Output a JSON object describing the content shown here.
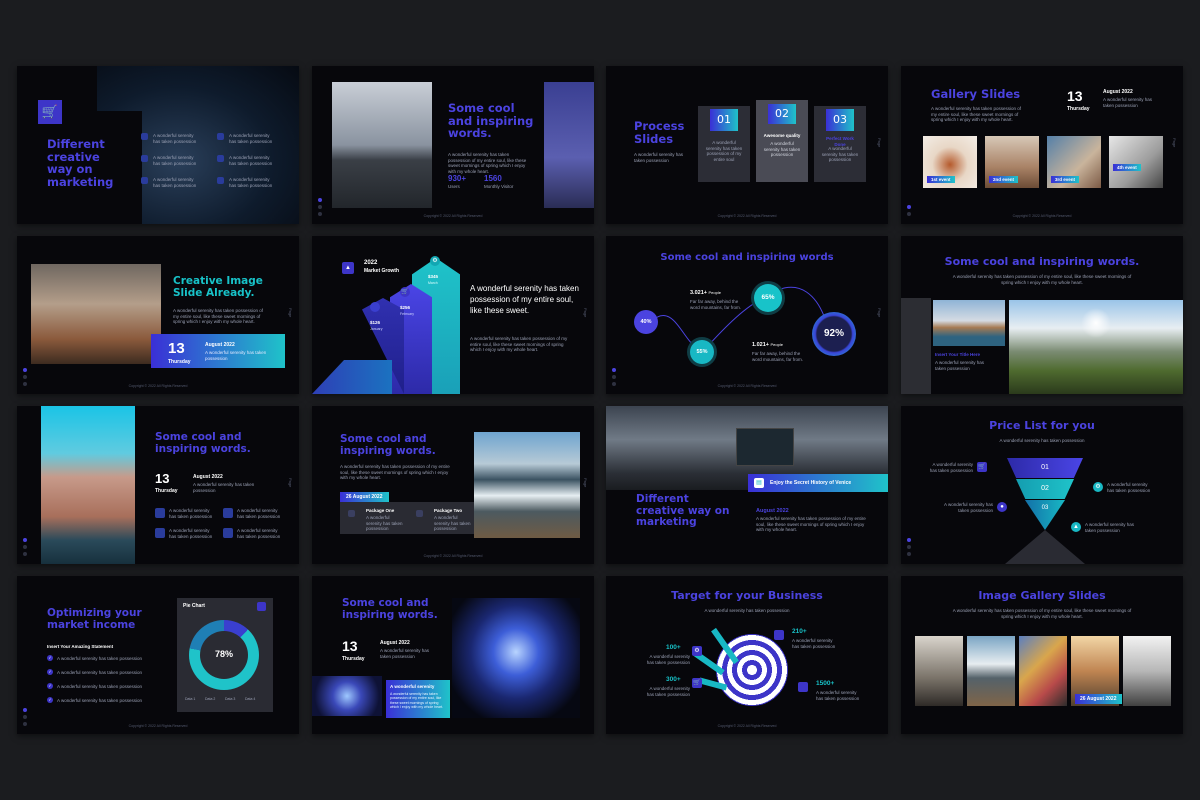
{
  "common": {
    "copyright": "Copyright © 2022 All Rights Reserved",
    "page_label": "Page",
    "body_short": "A wonderful serenity has taken possession",
    "body_long": "A wonderful serenity has taken possession of my entire soul, like these sweet mornings of spring which I enjoy with my whole heart."
  },
  "s1": {
    "title": "Different creative way on marketing",
    "cart_icon": "cart-icon"
  },
  "s2": {
    "title": "Some cool and inspiring words.",
    "stat1_value": "930+",
    "stat1_label": "Users",
    "stat2_value": "1560",
    "stat2_label": "Monthly Visitor"
  },
  "s3": {
    "title": "Process Slides",
    "steps": [
      {
        "num": "01",
        "label": "A wonderful serenity has taken possession of my entire soul"
      },
      {
        "num": "02",
        "label": "Awesome quality"
      },
      {
        "num": "03",
        "label": "Perfect Work Done"
      }
    ]
  },
  "s4": {
    "title": "Gallery Slides",
    "day": "13",
    "weekday": "Thursday",
    "month": "August 2022",
    "tags": [
      "1st event",
      "2nd event",
      "3rd event",
      "4th event"
    ]
  },
  "s5": {
    "title": "Creative Image Slide Already.",
    "day": "13",
    "weekday": "Thursday",
    "month": "August 2022"
  },
  "s6": {
    "year": "2022",
    "sub": "Market Growth",
    "bars": [
      "$126",
      "$256",
      "$345"
    ],
    "bar_labels": [
      "January",
      "February",
      "March"
    ],
    "headline": "A wonderful serenity has taken possession of my entire soul, like these sweet."
  },
  "s7": {
    "title": "Some cool and inspiring words",
    "p1": "40%",
    "p2": "55%",
    "p3": "65%",
    "p4": "92%",
    "n1": "3.021+",
    "n1l": "People",
    "n1t": "Far far away, behind the word mountains, far from.",
    "n2": "1.021+",
    "n2l": "People",
    "n2t": "Far far away, behind the word mountains, far from."
  },
  "s8": {
    "title": "Some cool and inspiring words.",
    "link": "Insert Your Title Here"
  },
  "s9": {
    "title": "Some cool and inspiring words.",
    "day": "13",
    "weekday": "Thursday",
    "month": "August 2022"
  },
  "s10": {
    "title": "Some cool and inspiring words.",
    "date": "26 August 2022",
    "pkg1": "Package One",
    "pkg2": "Package Two"
  },
  "s11": {
    "title": "Different creative way on marketing",
    "banner": "Enjoy the Secret History of Venice",
    "month": "August 2022"
  },
  "s12": {
    "title": "Price List for you",
    "levels": [
      "01",
      "02",
      "03"
    ]
  },
  "s13": {
    "title": "Optimizing your market income",
    "sub": "Insert Your Amazing Statement",
    "card_title": "Pie Chart",
    "pct": "78%",
    "legend": [
      "Data 1",
      "Data 2",
      "Data 3",
      "Data 4"
    ]
  },
  "s14": {
    "title": "Some cool and inspiring words.",
    "day": "13",
    "weekday": "Thursday",
    "month": "August 2022",
    "card": "A wonderful serenity"
  },
  "s15": {
    "title": "Target for your Business",
    "v1": "100+",
    "v2": "300+",
    "v3": "210+",
    "v4": "1500+"
  },
  "s16": {
    "title": "Image Gallery Slides",
    "tag": "26 August 2022"
  }
}
